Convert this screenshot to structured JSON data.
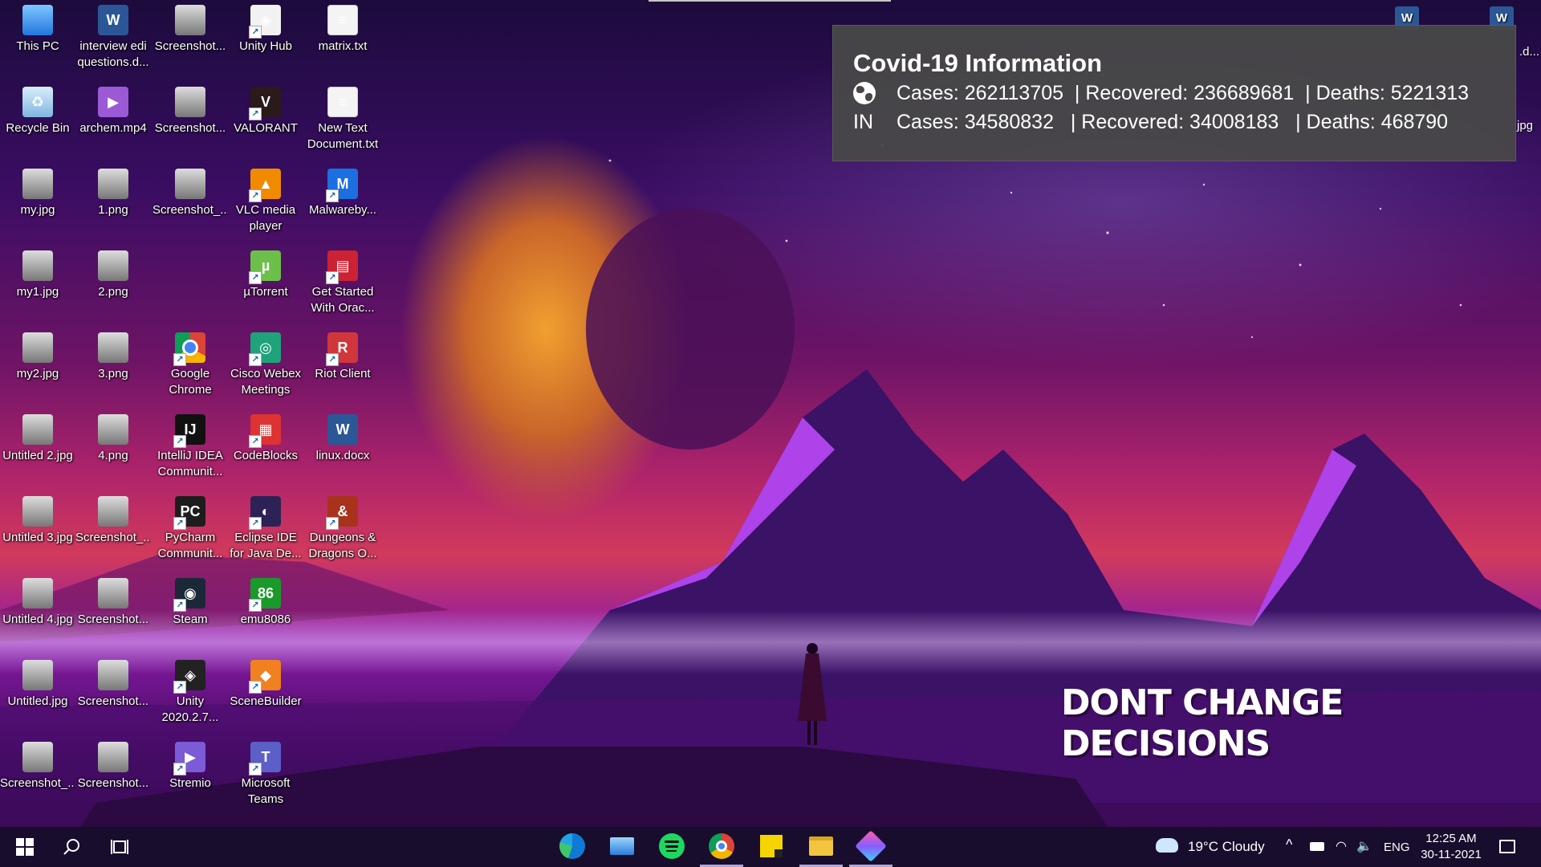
{
  "desktop": {
    "columns": [
      [
        {
          "label": "This PC",
          "icon": "this-pc-icon"
        },
        {
          "label": "Recycle Bin",
          "icon": "recycle-bin-icon"
        },
        {
          "label": "my.jpg",
          "icon": "image-file-icon"
        },
        {
          "label": "my1.jpg",
          "icon": "image-file-icon"
        },
        {
          "label": "my2.jpg",
          "icon": "image-file-icon"
        },
        {
          "label": "Untitled 2.jpg",
          "icon": "image-file-icon"
        },
        {
          "label": "Untitled 3.jpg",
          "icon": "image-file-icon"
        },
        {
          "label": "Untitled 4.jpg",
          "icon": "image-file-icon"
        },
        {
          "label": "Untitled.jpg",
          "icon": "image-file-icon"
        },
        {
          "label": "Screenshot_...",
          "icon": "image-file-icon"
        }
      ],
      [
        {
          "label": "interview edi questions.d...",
          "icon": "word-document-icon"
        },
        {
          "label": "archem.mp4",
          "icon": "video-file-icon"
        },
        {
          "label": "1.png",
          "icon": "image-file-icon"
        },
        {
          "label": "2.png",
          "icon": "image-file-icon"
        },
        {
          "label": "3.png",
          "icon": "image-file-icon"
        },
        {
          "label": "4.png",
          "icon": "image-file-icon"
        },
        {
          "label": "Screenshot_...",
          "icon": "image-file-icon"
        },
        {
          "label": "Screenshot...",
          "icon": "image-file-icon"
        },
        {
          "label": "Screenshot...",
          "icon": "image-file-icon"
        },
        {
          "label": "Screenshot...",
          "icon": "image-file-icon"
        }
      ],
      [
        {
          "label": "Screenshot...",
          "icon": "image-file-icon"
        },
        {
          "label": "Screenshot...",
          "icon": "image-file-icon"
        },
        {
          "label": "Screenshot_...",
          "icon": "image-file-icon"
        },
        {
          "label": "",
          "icon": ""
        },
        {
          "label": "Google Chrome",
          "icon": "chrome-icon"
        },
        {
          "label": "IntelliJ IDEA Communit...",
          "icon": "intellij-icon"
        },
        {
          "label": "PyCharm Communit...",
          "icon": "pycharm-icon"
        },
        {
          "label": "Steam",
          "icon": "steam-icon"
        },
        {
          "label": "Unity 2020.2.7...",
          "icon": "unity-icon"
        },
        {
          "label": "Stremio",
          "icon": "stremio-icon"
        }
      ],
      [
        {
          "label": "Unity Hub",
          "icon": "unity-hub-icon"
        },
        {
          "label": "VALORANT",
          "icon": "valorant-icon"
        },
        {
          "label": "VLC media player",
          "icon": "vlc-icon"
        },
        {
          "label": "µTorrent",
          "icon": "utorrent-icon"
        },
        {
          "label": "Cisco Webex Meetings",
          "icon": "webex-icon"
        },
        {
          "label": "CodeBlocks",
          "icon": "codeblocks-icon"
        },
        {
          "label": "Eclipse IDE for Java De...",
          "icon": "eclipse-icon"
        },
        {
          "label": "emu8086",
          "icon": "emu8086-icon"
        },
        {
          "label": "SceneBuilder",
          "icon": "scenebuilder-icon"
        },
        {
          "label": "Microsoft Teams",
          "icon": "teams-icon"
        }
      ],
      [
        {
          "label": "matrix.txt",
          "icon": "text-file-icon"
        },
        {
          "label": "New Text Document.txt",
          "icon": "text-file-icon"
        },
        {
          "label": "Malwareby...",
          "icon": "malwarebytes-icon"
        },
        {
          "label": "Get Started With Orac...",
          "icon": "oracle-icon"
        },
        {
          "label": "Riot Client",
          "icon": "riot-client-icon"
        },
        {
          "label": "linux.docx",
          "icon": "word-document-icon"
        },
        {
          "label": "Dungeons & Dragons O...",
          "icon": "dnd-icon"
        },
        {
          "label": "",
          "icon": ""
        },
        {
          "label": "",
          "icon": ""
        },
        {
          "label": "",
          "icon": ""
        }
      ]
    ],
    "edge_labels": {
      "right1": ".d...",
      "right2": "jpg"
    }
  },
  "covid_widget": {
    "title": "Covid-19 Information",
    "global_label_icon": "globe-icon",
    "global": "Cases: 262113705  | Recovered: 236689681  | Deaths: 5221313",
    "india_label": "IN",
    "india": "Cases: 34580832   | Recovered: 34008183   | Deaths: 468790"
  },
  "wallpaper": {
    "quote": "DONT CHANGE DECISIONS"
  },
  "taskbar": {
    "apps": [
      {
        "name": "edge-icon",
        "running": false
      },
      {
        "name": "this-pc-icon",
        "running": false
      },
      {
        "name": "spotify-icon",
        "running": false
      },
      {
        "name": "chrome-icon",
        "running": true
      },
      {
        "name": "sticky-notes-icon",
        "running": false
      },
      {
        "name": "file-explorer-icon",
        "running": true
      },
      {
        "name": "snipping-tool-icon",
        "running": true
      }
    ],
    "weather": "19°C  Cloudy",
    "language": "ENG",
    "time": "12:25 AM",
    "date": "30-11-2021"
  },
  "colors": {
    "taskbar": "#180e2c",
    "widget": "#484848",
    "running_indicator": "#b3a6d8"
  }
}
